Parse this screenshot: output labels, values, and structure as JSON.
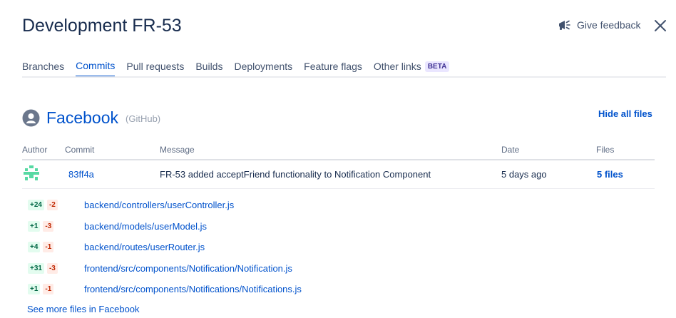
{
  "header": {
    "title": "Development FR-53",
    "feedback_label": "Give feedback"
  },
  "tabs": [
    {
      "label": "Branches",
      "active": false
    },
    {
      "label": "Commits",
      "active": true
    },
    {
      "label": "Pull requests",
      "active": false
    },
    {
      "label": "Builds",
      "active": false
    },
    {
      "label": "Deployments",
      "active": false
    },
    {
      "label": "Feature flags",
      "active": false
    },
    {
      "label": "Other links",
      "active": false,
      "badge": "BETA"
    }
  ],
  "repo": {
    "name": "Facebook",
    "host": "(GitHub)",
    "hide_files_label": "Hide all files"
  },
  "table": {
    "headers": {
      "author": "Author",
      "commit": "Commit",
      "message": "Message",
      "date": "Date",
      "files": "Files"
    },
    "commit": {
      "hash": "83ff4a",
      "message": "FR-53 added acceptFriend functionality to Notification Component",
      "date": "5 days ago",
      "files": "5 files"
    }
  },
  "files": [
    {
      "added": "+24",
      "removed": "-2",
      "path": "backend/controllers/userController.js"
    },
    {
      "added": "+1",
      "removed": "-3",
      "path": "backend/models/userModel.js"
    },
    {
      "added": "+4",
      "removed": "-1",
      "path": "backend/routes/userRouter.js"
    },
    {
      "added": "+31",
      "removed": "-3",
      "path": "frontend/src/components/Notification/Notification.js"
    },
    {
      "added": "+1",
      "removed": "-1",
      "path": "frontend/src/components/Notifications/Notifications.js"
    }
  ],
  "see_more_label": "See more files in Facebook",
  "colors": {
    "link": "#0052cc",
    "text": "#172b4d",
    "muted": "#5e6c84",
    "added_bg": "#e3fcef",
    "removed_bg": "#ffebe6"
  }
}
